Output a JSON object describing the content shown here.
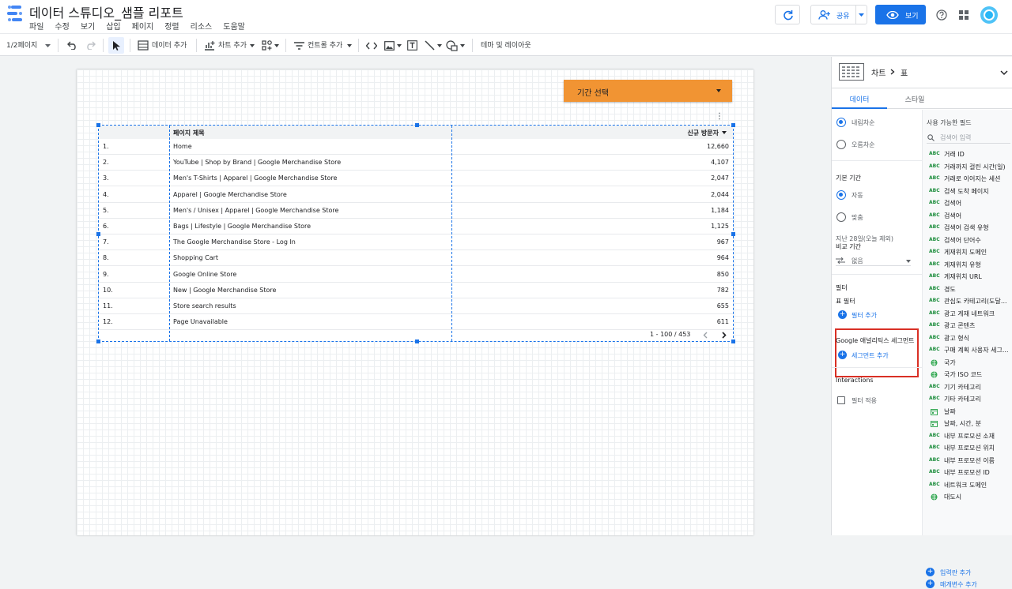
{
  "header": {
    "title": "데이터 스튜디오_샘플 리포트",
    "menu": [
      "파일",
      "수정",
      "보기",
      "삽입",
      "페이지",
      "정렬",
      "리소스",
      "도움말"
    ],
    "share_label": "공유",
    "view_label": "보기"
  },
  "toolbar": {
    "page_indicator": "1/2페이지",
    "add_data": "데이터 추가",
    "add_chart": "차트 추가",
    "add_control": "컨트롤 추가",
    "theme_layout": "테마 및 레이아웃"
  },
  "canvas": {
    "date_picker_label": "기간 선택"
  },
  "table": {
    "headers": [
      "페이지 제목",
      "신규 방문자"
    ],
    "rows": [
      {
        "idx": "1.",
        "title": "Home",
        "value": "12,660"
      },
      {
        "idx": "2.",
        "title": "YouTube | Shop by Brand | Google Merchandise Store",
        "value": "4,107"
      },
      {
        "idx": "3.",
        "title": "Men's T-Shirts | Apparel | Google Merchandise Store",
        "value": "2,047"
      },
      {
        "idx": "4.",
        "title": "Apparel | Google Merchandise Store",
        "value": "2,044"
      },
      {
        "idx": "5.",
        "title": "Men's / Unisex | Apparel | Google Merchandise Store",
        "value": "1,184"
      },
      {
        "idx": "6.",
        "title": "Bags | Lifestyle | Google Merchandise Store",
        "value": "1,125"
      },
      {
        "idx": "7.",
        "title": "The Google Merchandise Store - Log In",
        "value": "967"
      },
      {
        "idx": "8.",
        "title": "Shopping Cart",
        "value": "964"
      },
      {
        "idx": "9.",
        "title": "Google Online Store",
        "value": "850"
      },
      {
        "idx": "10.",
        "title": "New | Google Merchandise Store",
        "value": "782"
      },
      {
        "idx": "11.",
        "title": "Store search results",
        "value": "655"
      },
      {
        "idx": "12.",
        "title": "Page Unavailable",
        "value": "611"
      }
    ],
    "pagination": "1 - 100 / 453"
  },
  "panel": {
    "breadcrumb_chart": "차트",
    "breadcrumb_type": "표",
    "tab_data": "데이터",
    "tab_style": "스타일",
    "sort_desc": "내림차순",
    "sort_asc": "오름차순",
    "default_range_title": "기본 기간",
    "range_auto": "자동",
    "range_custom": "맞춤",
    "range_desc": "지난 28일(오늘 제외)",
    "compare_title": "비교 기간",
    "compare_value": "없음",
    "filter_title": "필터",
    "table_filter": "표 필터",
    "add_filter": "필터 추가",
    "segment_title": "Google 애널리틱스 세그먼트",
    "add_segment": "세그먼트 추가",
    "interactions_title": "Interactions",
    "apply_filter": "필터 적용",
    "available_fields": "사용 가능한 필드",
    "search_placeholder": "검색어 입력",
    "fields": [
      {
        "type": "ABC",
        "name": "거래 ID"
      },
      {
        "type": "ABC",
        "name": "거래까지 걸린 시간(일)"
      },
      {
        "type": "ABC",
        "name": "거래로 이어지는 세션"
      },
      {
        "type": "ABC",
        "name": "검색 도착 페이지"
      },
      {
        "type": "ABC",
        "name": "검색어"
      },
      {
        "type": "ABC",
        "name": "검색어"
      },
      {
        "type": "ABC",
        "name": "검색어 검색 유형"
      },
      {
        "type": "ABC",
        "name": "검색어 단어수"
      },
      {
        "type": "ABC",
        "name": "게재위치 도메인"
      },
      {
        "type": "ABC",
        "name": "게재위치 유형"
      },
      {
        "type": "ABC",
        "name": "게재위치 URL"
      },
      {
        "type": "ABC",
        "name": "경도"
      },
      {
        "type": "ABC",
        "name": "관심도 카테고리(도달..."
      },
      {
        "type": "ABC",
        "name": "광고 게재 네트워크"
      },
      {
        "type": "ABC",
        "name": "광고 콘텐츠"
      },
      {
        "type": "ABC",
        "name": "광고 형식"
      },
      {
        "type": "ABC",
        "name": "구매 계획 사용자 세그..."
      },
      {
        "type": "geo",
        "name": "국가"
      },
      {
        "type": "geo",
        "name": "국가 ISO 코드"
      },
      {
        "type": "ABC",
        "name": "기기 카테고리"
      },
      {
        "type": "ABC",
        "name": "기타 카테고리"
      },
      {
        "type": "date",
        "name": "날짜"
      },
      {
        "type": "date",
        "name": "날짜, 시간, 분"
      },
      {
        "type": "ABC",
        "name": "내부 프로모션 소재"
      },
      {
        "type": "ABC",
        "name": "내부 프로모션 위치"
      },
      {
        "type": "ABC",
        "name": "내부 프로모션 이름"
      },
      {
        "type": "ABC",
        "name": "내부 프로모션 ID"
      },
      {
        "type": "ABC",
        "name": "네트워크 도메인"
      },
      {
        "type": "geo",
        "name": "대도시"
      }
    ],
    "add_field": "입력란 추가",
    "add_parameter": "매개변수 추가"
  }
}
